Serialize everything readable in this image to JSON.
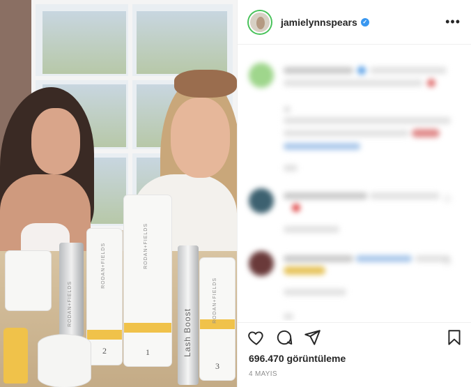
{
  "post": {
    "username": "jamielynnspears",
    "verified": true,
    "views_label": "696.470 görüntüleme",
    "date_label": "4 MAYIS",
    "more_icon": "more-horizontal-icon",
    "media_description_icon": "video-post"
  },
  "products": [
    {
      "brand": "RODAN+FIELDS",
      "number": ""
    },
    {
      "brand": "RODAN+FIELDS",
      "number": "2"
    },
    {
      "brand": "RODAN+FIELDS",
      "number": "1"
    },
    {
      "brand": "Lash Boost",
      "number": ""
    },
    {
      "brand": "RODAN+FIELDS",
      "number": "3"
    }
  ],
  "actions": {
    "like_icon": "heart-icon",
    "comment_icon": "comment-icon",
    "share_icon": "share-icon",
    "save_icon": "bookmark-icon"
  },
  "colors": {
    "verified_badge": "#3897f0",
    "story_ring": "#48c25a",
    "product_band": "#f0c24a"
  }
}
